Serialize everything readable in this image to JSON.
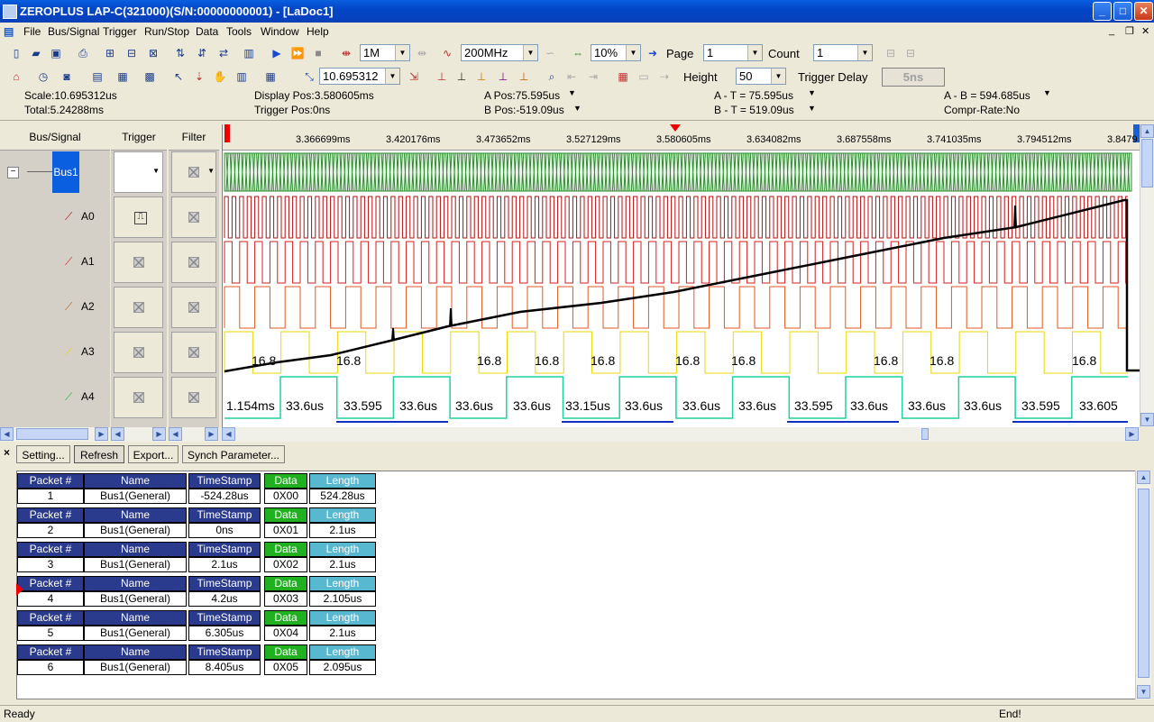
{
  "window": {
    "title": "ZEROPLUS LAP-C(321000)(S/N:00000000001) - [LaDoc1]"
  },
  "menu": [
    "File",
    "Bus/Signal",
    "Trigger",
    "Run/Stop",
    "Data",
    "Tools",
    "Window",
    "Help"
  ],
  "toolbar1": {
    "sample_depth": "1M",
    "sample_rate": "200MHz",
    "zoom": "10%",
    "page_label": "Page",
    "page_value": "1",
    "count_label": "Count",
    "count_value": "1"
  },
  "toolbar2": {
    "scale_value": "10.695312",
    "height_label": "Height",
    "height_value": "50",
    "trigger_delay_label": "Trigger Delay",
    "trigger_delay_value": "5ns"
  },
  "info": {
    "scale": "Scale:10.695312us",
    "total": "Total:5.24288ms",
    "display_pos": "Display Pos:3.580605ms",
    "trigger_pos": "Trigger Pos:0ns",
    "a_pos": "A Pos:75.595us",
    "b_pos": "B Pos:-519.09us",
    "a_t": "A - T = 75.595us",
    "b_t": "B - T = 519.09us",
    "a_b": "A - B = 594.685us",
    "compr": "Compr-Rate:No"
  },
  "panel": {
    "bus_signal_header": "Bus/Signal",
    "trigger_header": "Trigger",
    "filter_header": "Filter",
    "bus_name": "Bus1",
    "signals": [
      "A0",
      "A1",
      "A2",
      "A3",
      "A4"
    ]
  },
  "ruler": {
    "ticks": [
      "3.366699ms",
      "3.420176ms",
      "3.473652ms",
      "3.527129ms",
      "3.580605ms",
      "3.634082ms",
      "3.687558ms",
      "3.741035ms",
      "3.794512ms",
      "3.8479"
    ]
  },
  "wave": {
    "a3_labels": [
      "16.8",
      "16.8",
      "16.8",
      "16.8",
      "16.8",
      "16.8",
      "16.8",
      "16.8",
      "16.8",
      "16.8"
    ],
    "a4_labels": [
      "1.154ms",
      "33.6us",
      "33.595",
      "33.6us",
      "33.6us",
      "33.6us",
      "33.15us",
      "33.6us",
      "33.6us",
      "33.6us",
      "33.595",
      "33.6us",
      "33.6us",
      "33.6us",
      "33.595",
      "33.605"
    ],
    "colors": {
      "bus": "#2e8b2e",
      "a0": "#b01010",
      "a1": "#d02020",
      "a2": "#e05a20",
      "a3": "#e8d800",
      "a4": "#20d0a0",
      "a5": "#1030c0"
    }
  },
  "packet_toolbar": {
    "setting": "Setting...",
    "refresh": "Refresh",
    "export": "Export...",
    "synch": "Synch Parameter..."
  },
  "packets": {
    "headers": [
      "Packet #",
      "Name",
      "TimeStamp",
      "Data",
      "Length"
    ],
    "rows": [
      [
        "1",
        "Bus1(General)",
        "-524.28us",
        "0X00",
        "524.28us"
      ],
      [
        "2",
        "Bus1(General)",
        "0ns",
        "0X01",
        "2.1us"
      ],
      [
        "3",
        "Bus1(General)",
        "2.1us",
        "0X02",
        "2.1us"
      ],
      [
        "4",
        "Bus1(General)",
        "4.2us",
        "0X03",
        "2.105us"
      ],
      [
        "5",
        "Bus1(General)",
        "6.305us",
        "0X04",
        "2.1us"
      ],
      [
        "6",
        "Bus1(General)",
        "8.405us",
        "0X05",
        "2.095us"
      ]
    ]
  },
  "status": {
    "left": "Ready",
    "right": "End!"
  }
}
